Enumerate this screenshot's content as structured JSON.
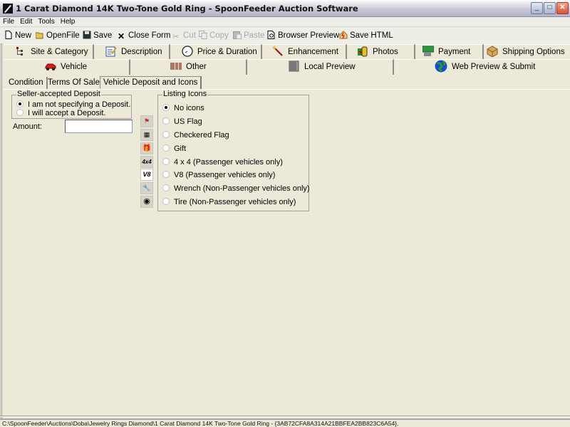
{
  "window": {
    "title": "1 Carat Diamond 14K Two-Tone Gold Ring - SpoonFeeder Auction Software",
    "minimize": "_",
    "maximize": "□",
    "close": "✕"
  },
  "menu": [
    "File",
    "Edit",
    "Tools",
    "Help"
  ],
  "toolbar": [
    {
      "label": "New",
      "icon": "new-document-icon",
      "enabled": true
    },
    {
      "label": "OpenFile",
      "icon": "open-folder-icon",
      "enabled": true
    },
    {
      "label": "Save",
      "icon": "floppy-disk-icon",
      "enabled": true
    },
    {
      "label": "Close Form",
      "icon": "close-x-icon",
      "enabled": true
    },
    {
      "label": "Cut",
      "icon": "scissors-icon",
      "enabled": false
    },
    {
      "label": "Copy",
      "icon": "copy-icon",
      "enabled": false
    },
    {
      "label": "Paste",
      "icon": "paste-icon",
      "enabled": false
    },
    {
      "label": "Browser Preview",
      "icon": "browser-preview-icon",
      "enabled": true
    },
    {
      "label": "Save HTML",
      "icon": "save-html-icon",
      "enabled": true
    }
  ],
  "tabs_row1": [
    {
      "label": "Site & Category",
      "icon": "tree-icon"
    },
    {
      "label": "Description",
      "icon": "notepad-pencil-icon"
    },
    {
      "label": "Price & Duration",
      "icon": "clock-icon"
    },
    {
      "label": "Enhancement",
      "icon": "magic-wand-icon"
    },
    {
      "label": "Photos",
      "icon": "film-roll-icon"
    },
    {
      "label": "Payment",
      "icon": "money-icon"
    },
    {
      "label": "Shipping Options",
      "icon": "package-icon"
    }
  ],
  "tabs_row2": [
    {
      "label": "Vehicle",
      "icon": "red-car-icon",
      "active": true
    },
    {
      "label": "Other",
      "icon": "barcode-icon"
    },
    {
      "label": "Local Preview",
      "icon": "monitor-icon"
    },
    {
      "label": "Web Preview & Submit",
      "icon": "globe-icon"
    }
  ],
  "subtabs": [
    {
      "label": "Condition"
    },
    {
      "label": "Terms Of Sale"
    },
    {
      "label": "Vehicle Deposit and Icons",
      "active": true
    }
  ],
  "deposit": {
    "group_label": "Seller-accepted Deposit",
    "options": [
      {
        "label": "I am not specifying a Deposit.",
        "checked": true
      },
      {
        "label": "I will accept a Deposit.",
        "checked": false
      }
    ],
    "amount_label": "Amount:",
    "amount_value": ""
  },
  "listing_icons": {
    "group_label": "Listing Icons",
    "options": [
      {
        "label": "No icons",
        "checked": true,
        "icon": ""
      },
      {
        "label": "US Flag",
        "checked": false,
        "icon": "us-flag-icon"
      },
      {
        "label": "Checkered Flag",
        "checked": false,
        "icon": "checkered-flag-icon"
      },
      {
        "label": "Gift",
        "checked": false,
        "icon": "gift-icon"
      },
      {
        "label": "4 x 4 (Passenger vehicles only)",
        "checked": false,
        "icon": "4x4-icon"
      },
      {
        "label": "V8 (Passenger vehicles only)",
        "checked": false,
        "icon": "v8-icon"
      },
      {
        "label": "Wrench (Non-Passenger vehicles only)",
        "checked": false,
        "icon": "wrench-icon"
      },
      {
        "label": "Tire (Non-Passenger vehicles only)",
        "checked": false,
        "icon": "tire-icon"
      }
    ],
    "tile_glyphs": [
      "",
      "⚑",
      "▦",
      "🎁",
      "4x4",
      "V8",
      "🔧",
      "◉"
    ]
  },
  "status": {
    "path": "C:\\SpoonFeeder\\Auctions\\Doba\\Jewelry Rings Diamond\\1 Carat Diamond 14K Two-Tone Gold Ring - {3AB72CFA8A314A21BBFEA2BB823C6A54}."
  }
}
